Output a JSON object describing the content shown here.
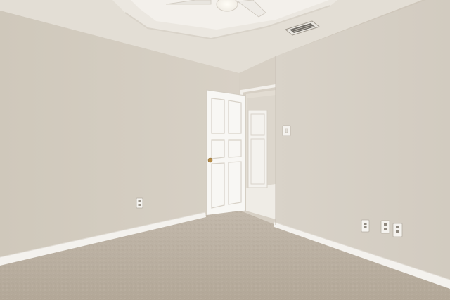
{
  "scene": {
    "subject": "empty-carpeted-bedroom",
    "palette": {
      "wall_left": "#d2cbbf",
      "wall_right": "#d6d0c6",
      "ceiling": "#e6e1d9",
      "tray_ceiling": "#efece7",
      "carpet": "#b9aea1",
      "trim": "#f4f2ee",
      "door": "#f7f6f3",
      "hallway": "#e4ded5"
    },
    "fixtures": [
      "ceiling-fan-light-icon",
      "air-vent-icon",
      "interior-door-icon",
      "light-switch-icon",
      "outlet-icon"
    ]
  }
}
